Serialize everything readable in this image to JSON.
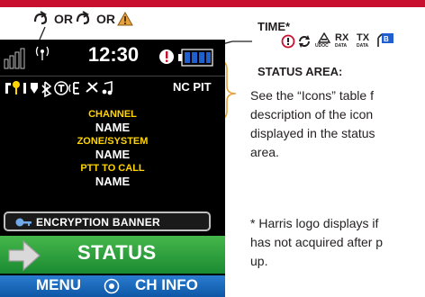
{
  "symbols": {
    "or_1": "OR",
    "or_2": "OR"
  },
  "device": {
    "time": "12:30",
    "nc_pit": "NC PIT",
    "lines": [
      "CHANNEL",
      "NAME",
      "ZONE/SYSTEM",
      "NAME",
      "PTT TO CALL",
      "NAME"
    ],
    "encryption_banner": "ENCRYPTION BANNER",
    "status": "STATUS",
    "menu": "MENU",
    "ch_info": "CH INFO"
  },
  "callouts": {
    "time_label": "TIME*",
    "rx_label": "RX",
    "tx_label": "TX",
    "udoc": "UDOC",
    "data_1": "DATA",
    "data_2": "DATA",
    "status_area_label": "STATUS AREA:",
    "description": [
      "See the “Icons” table f",
      "description of the icon",
      "displayed in the status",
      "area."
    ],
    "footnote": [
      "* Harris logo displays if",
      "has not acquired after p",
      "up."
    ]
  },
  "colors": {
    "strip_red": "#c8102e",
    "status_green": "#2ea043",
    "menu_blue": "#0e57a6",
    "text_yellow": "#ffd400",
    "battery_blue": "#1f5fcf"
  }
}
